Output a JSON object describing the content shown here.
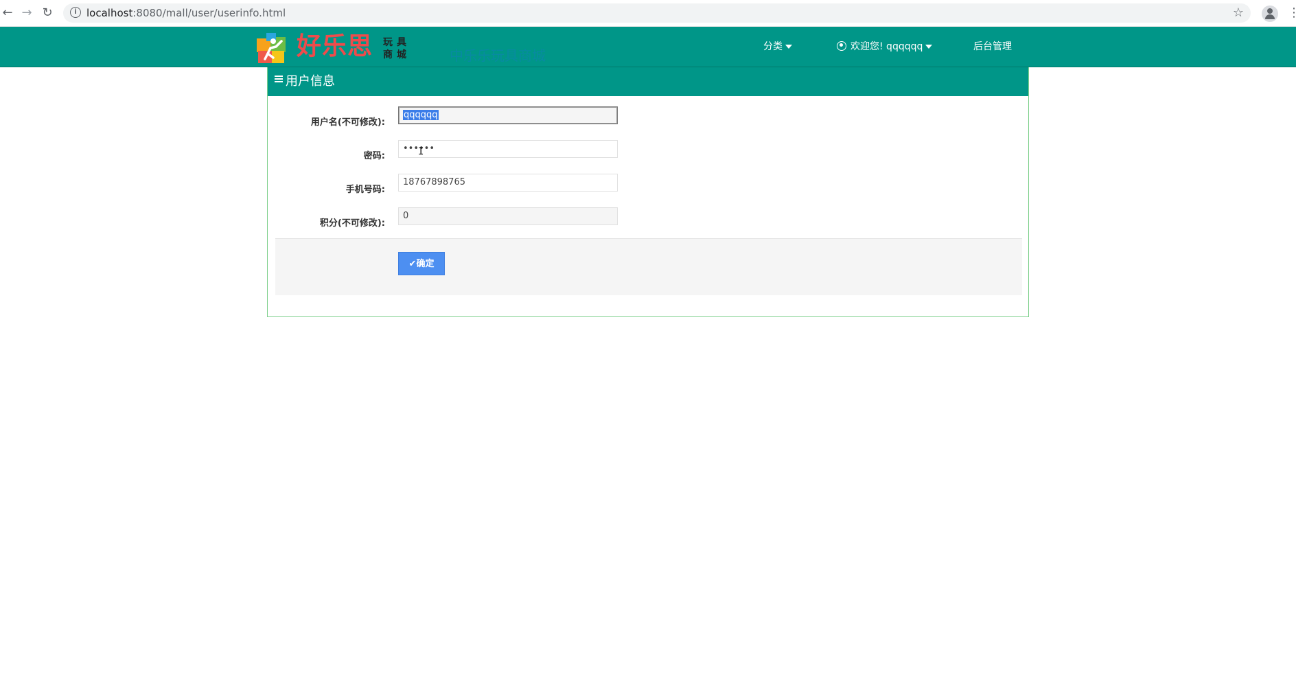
{
  "browser": {
    "url_host": "localhost",
    "url_path": ":8080/mall/user/userinfo.html",
    "back_icon": "arrow-left-icon",
    "forward_icon": "arrow-right-icon",
    "reload_icon": "reload-icon"
  },
  "header": {
    "logo_main": "好乐思",
    "logo_sub": "玩具商城",
    "ghost_link": "中乐乐玩具商城",
    "nav": {
      "category": "分类",
      "welcome": "欢迎您! qqqqqq",
      "admin": "后台管理"
    },
    "colors": {
      "primary": "#009688",
      "logo_red": "#ef4b4b"
    }
  },
  "panel": {
    "title": "用户信息",
    "fields": [
      {
        "label": "用户名(不可修改):",
        "value": "qqqqqq"
      },
      {
        "label": "密码:",
        "value": "••••••"
      },
      {
        "label": "手机号码:",
        "value": "18767898765"
      },
      {
        "label": "积分(不可修改):",
        "value": "0"
      }
    ],
    "submit_label": "确定"
  }
}
